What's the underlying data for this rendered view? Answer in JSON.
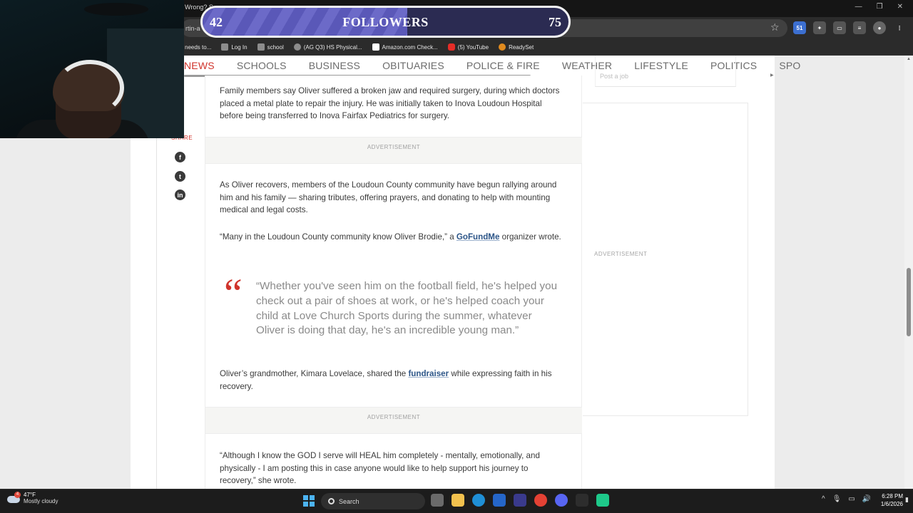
{
  "browser": {
    "tab_title_fragment": "Wrong? S",
    "url_fragment": "rtin-a",
    "bookmarks": [
      {
        "label": "needs to...",
        "icon": "none"
      },
      {
        "label": "Log In",
        "icon": "bookmark-icon"
      },
      {
        "label": "school",
        "icon": "bookmark-icon"
      },
      {
        "label": "(AG Q3) HS Physical...",
        "icon": "globe-icon"
      },
      {
        "label": "Amazon.com Check...",
        "icon": "amazon-icon"
      },
      {
        "label": "(5) YouTube",
        "icon": "youtube-icon"
      },
      {
        "label": "ReadySet",
        "icon": "readyset-icon"
      }
    ],
    "extension_badge": "51"
  },
  "nav": {
    "items": [
      "NEWS",
      "SCHOOLS",
      "BUSINESS",
      "OBITUARIES",
      "POLICE & FIRE",
      "WEATHER",
      "LIFESTYLE",
      "POLITICS",
      "SPO"
    ],
    "active_index": 0
  },
  "share": {
    "label": "SHARE"
  },
  "article": {
    "p1": "Family members say Oliver suffered a broken jaw and required surgery, during which doctors placed a metal plate to repair the injury. He was initially taken to Inova Loudoun Hospital before being transferred to Inova Fairfax Pediatrics for surgery.",
    "ad_label": "ADVERTISEMENT",
    "p2": "As Oliver recovers, members of the Loudoun County community have begun rallying around him and his family — sharing tributes, offering prayers, and donating to help with mounting medical and legal costs.",
    "p3_before": "“Many in the Loudoun County community know Oliver Brodie,” a ",
    "p3_link": "GoFundMe",
    "p3_after": " organizer wrote.",
    "quote_mark": "“",
    "quote": "“Whether you've seen him on the football field, he's helped you check out a pair of shoes at work, or he's helped coach your child at Love Church Sports during the summer, whatever Oliver is doing that day, he's an incredible young man.”",
    "p4_before": "Oliver’s grandmother, Kimara Lovelace, shared the ",
    "p4_link": "fundraiser",
    "p4_after": " while expressing faith in his recovery.",
    "p5": "“Although I know the GOD I serve will HEAL him completely - mentally, emotionally, and physically - I am posting this in case anyone would like to help support his journey to recovery,” she wrote."
  },
  "sidebar": {
    "top_text": "Post a job",
    "ad_label": "ADVERTISEMENT"
  },
  "overlay": {
    "followers_current": "42",
    "followers_label": "FOLLOWERS",
    "followers_goal": "75",
    "progress_fraction": 0.56
  },
  "taskbar": {
    "weather_badge": "4",
    "temperature": "47°F",
    "condition": "Mostly cloudy",
    "search_placeholder": "Search",
    "time": "6:28 PM",
    "date": "1/6/2026"
  }
}
